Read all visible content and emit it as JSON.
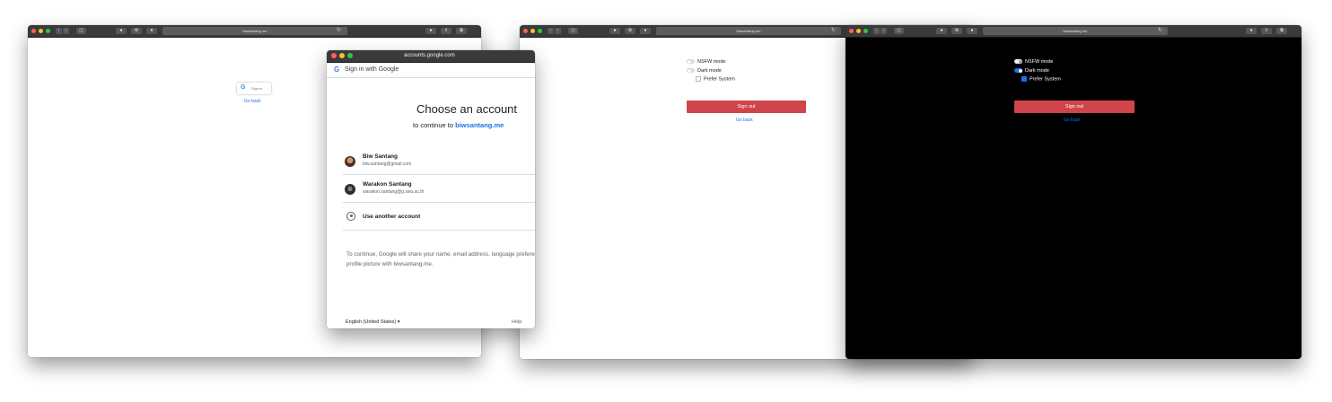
{
  "browser": {
    "url": "biwsantang.me",
    "back_glyph": "‹",
    "forward_glyph": "›",
    "sidebar_glyph": "◫",
    "reload_glyph": "↻",
    "ext_glyphs": [
      "●",
      "⚙",
      "●"
    ],
    "right_glyphs": [
      "●",
      "⇪",
      "⧉"
    ]
  },
  "window_signin": {
    "google_g": "G",
    "signin_label": "Sign in",
    "go_back": "Go back"
  },
  "google_popup": {
    "url": "accounts.google.com",
    "header_g": "G",
    "header_title": "Sign in with Google",
    "title": "Choose an account",
    "continue_prefix": "to continue to ",
    "continue_site": "biwsantang.me",
    "accounts": [
      {
        "name": "Biw Santang",
        "email": "biw.santang@gmail.com"
      },
      {
        "name": "Warakon Santang",
        "email": "warakon.santang@g.swu.ac.th"
      }
    ],
    "another": "Use another account",
    "notice": "To continue, Google will share your name, email address, language preference, and profile picture with biwsantang.me.",
    "language": "English (United States)",
    "language_caret": "▾",
    "help": "Help"
  },
  "settings_light": {
    "nsfw": "NSFW mode",
    "dark": "Dark mode",
    "prefer": "Prefer System",
    "signout": "Sign out",
    "go_back": "Go back",
    "nsfw_on": false,
    "dark_on": false,
    "prefer_checked": false
  },
  "settings_dark": {
    "nsfw": "NSFW mode",
    "dark": "Dark mode",
    "prefer": "Prefer System",
    "signout": "Sign out",
    "go_back": "Go back",
    "nsfw_on": true,
    "dark_on": true,
    "prefer_checked": true
  },
  "colors": {
    "accent": "#1a73e8",
    "signout": "#d0454b",
    "dark_bg": "#000000"
  }
}
